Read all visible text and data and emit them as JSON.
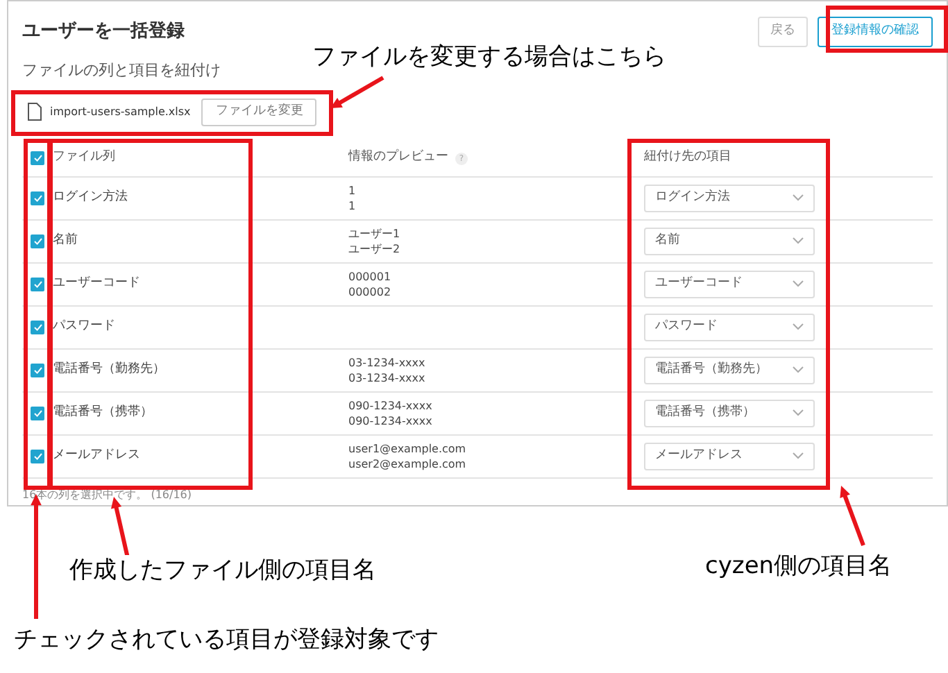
{
  "header": {
    "title": "ユーザーを一括登録",
    "buttons": [
      {
        "label": "戻る",
        "kind": "secondary"
      },
      {
        "label": "登録情報の確認",
        "kind": "primary"
      }
    ]
  },
  "subtitle": "ファイルの列と項目を紐付け",
  "file": {
    "name": "import-users-sample.xlsx",
    "button": "ファイルを変更"
  },
  "table": {
    "all_checked": true,
    "columns": [
      "ファイル列",
      "情報のプレビュー",
      "紐付け先の項目"
    ],
    "help": "?",
    "rows": [
      {
        "checked": true,
        "column": "ログイン方法",
        "preview": [
          "1",
          "1"
        ],
        "target": "ログイン方法"
      },
      {
        "checked": true,
        "column": "名前",
        "preview": [
          "ユーザー1",
          "ユーザー2"
        ],
        "target": "名前"
      },
      {
        "checked": true,
        "column": "ユーザーコード",
        "preview": [
          "000001",
          "000002"
        ],
        "target": "ユーザーコード"
      },
      {
        "checked": true,
        "column": "パスワード",
        "preview": [],
        "target": "パスワード"
      },
      {
        "checked": true,
        "column": "電話番号（勤務先）",
        "preview": [
          "03-1234-xxxx",
          "03-1234-xxxx"
        ],
        "target": "電話番号（勤務先）"
      },
      {
        "checked": true,
        "column": "電話番号（携帯）",
        "preview": [
          "090-1234-xxxx",
          "090-1234-xxxx"
        ],
        "target": "電話番号（携帯）"
      },
      {
        "checked": true,
        "column": "メールアドレス",
        "preview": [
          "user1@example.com",
          "user2@example.com"
        ],
        "target": "メールアドレス"
      }
    ]
  },
  "status": "16本の列を選択中です。 (16/16)",
  "annotations": [
    "ファイルを変更する場合はこちら",
    "作成したファイル側の項目名",
    "cyzen側の項目名",
    "チェックされている項目が登録対象です"
  ]
}
